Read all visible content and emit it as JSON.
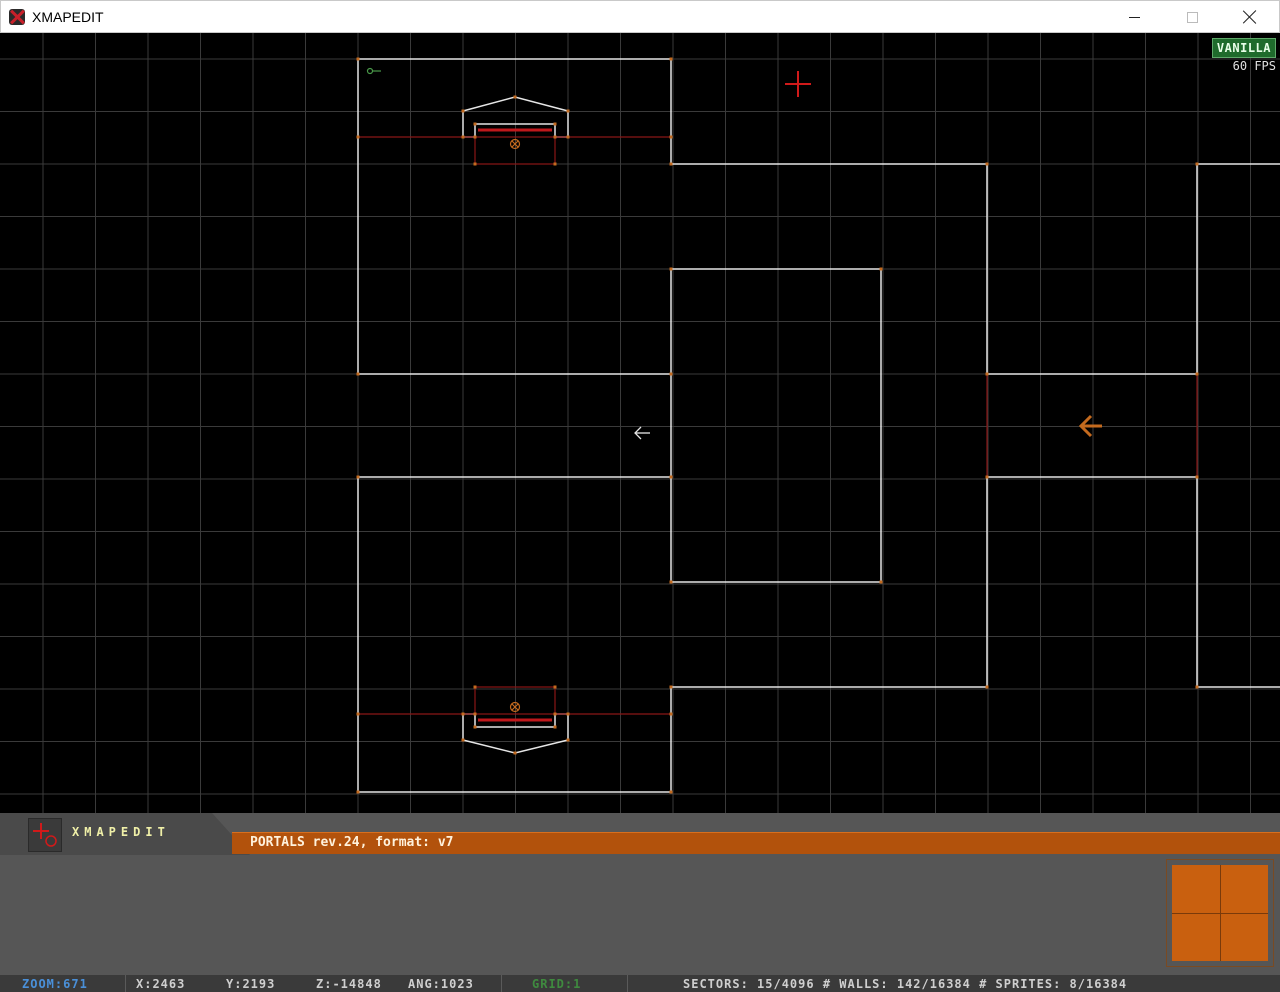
{
  "window": {
    "title": "XMAPEDIT",
    "minimize_label": "minimize",
    "maximize_label": "maximize",
    "close_label": "close"
  },
  "viewport": {
    "badge": "VANILLA",
    "fps": "60 FPS"
  },
  "panel": {
    "logo_text": "XMAPEDIT",
    "status_message": "PORTALS rev.24, format: v7"
  },
  "statusbar": {
    "zoom": "ZOOM:671",
    "x": "X:2463",
    "y": "Y:2193",
    "z": "Z:-14848",
    "ang": "ANG:1023",
    "grid": "GRID:1",
    "counts": "SECTORS: 15/4096 # WALLS: 142/16384 # SPRITES: 8/16384"
  },
  "colors": {
    "wall": "#e6e6e6",
    "red_wall": "#8a1616",
    "vertex": "#c46a1e",
    "grid": "#3a3a3a",
    "accent": "#b2520c"
  }
}
